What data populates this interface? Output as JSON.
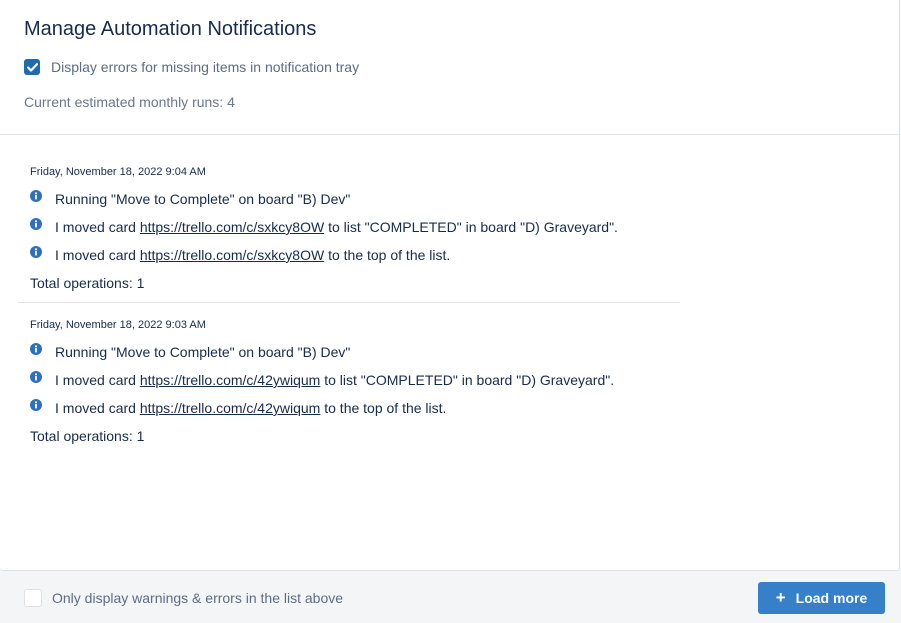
{
  "header": {
    "title": "Manage Automation Notifications",
    "display_errors_label": "Display errors for missing items in notification tray",
    "display_errors_checked": true,
    "runs_text": "Current estimated monthly runs: 4"
  },
  "entries": [
    {
      "timestamp": "Friday, November 18, 2022 9:04 AM",
      "line1": "Running \"Move to Complete\" on board \"B) Dev\"",
      "line2_prefix": "I moved card ",
      "line2_link": "https://trello.com/c/sxkcy8OW",
      "line2_suffix": " to list \"COMPLETED\" in board \"D) Graveyard\".",
      "line3_prefix": "I moved card ",
      "line3_link": "https://trello.com/c/sxkcy8OW",
      "line3_suffix": " to the top of the list.",
      "total": "Total operations: 1"
    },
    {
      "timestamp": "Friday, November 18, 2022 9:03 AM",
      "line1": "Running \"Move to Complete\" on board \"B) Dev\"",
      "line2_prefix": "I moved card ",
      "line2_link": "https://trello.com/c/42ywiqum",
      "line2_suffix": " to list \"COMPLETED\" in board \"D) Graveyard\".",
      "line3_prefix": "I moved card ",
      "line3_link": "https://trello.com/c/42ywiqum",
      "line3_suffix": " to the top of the list.",
      "total": "Total operations: 1"
    }
  ],
  "footer": {
    "filter_label": "Only display warnings & errors in the list above",
    "filter_checked": false,
    "load_more_label": "Load more",
    "load_more_icon": "plus-icon"
  },
  "colors": {
    "accent": "#3580c9",
    "checkbox": "#1f6bb0",
    "info_icon": "#2f6fbf",
    "text": "#172b4d",
    "muted": "#5e6c84"
  }
}
